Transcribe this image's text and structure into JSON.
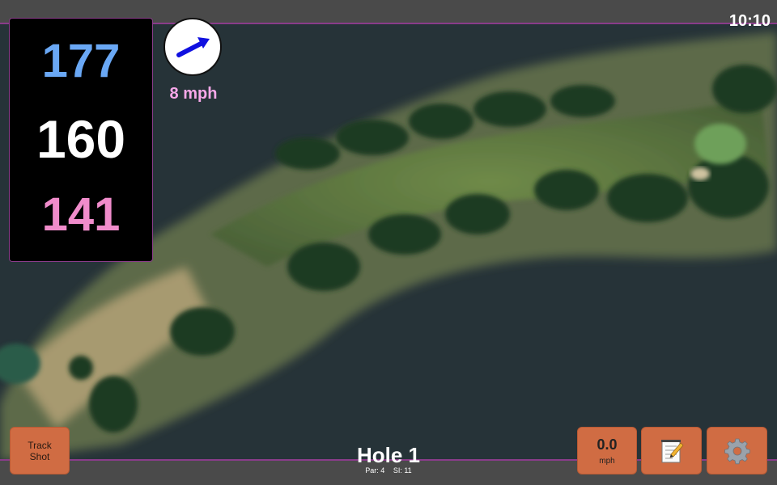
{
  "status": {
    "time": "10:10"
  },
  "distances": {
    "back": "177",
    "middle": "160",
    "front": "141"
  },
  "wind": {
    "speed": "8 mph",
    "icon": "wind-arrow-icon",
    "color": "#1010e0"
  },
  "hole": {
    "title": "Hole 1",
    "par": "Par: 4",
    "si": "SI: 11"
  },
  "buttons": {
    "track_shot": [
      "Track",
      "Shot"
    ],
    "speed_value": "0.0",
    "speed_unit": "mph",
    "notes_icon": "notepad-icon",
    "settings_icon": "gear-icon"
  },
  "colors": {
    "back_distance": "#6aa8f5",
    "front_distance": "#f08ccb",
    "button": "#d06c43",
    "accent": "#8a3c8a"
  }
}
